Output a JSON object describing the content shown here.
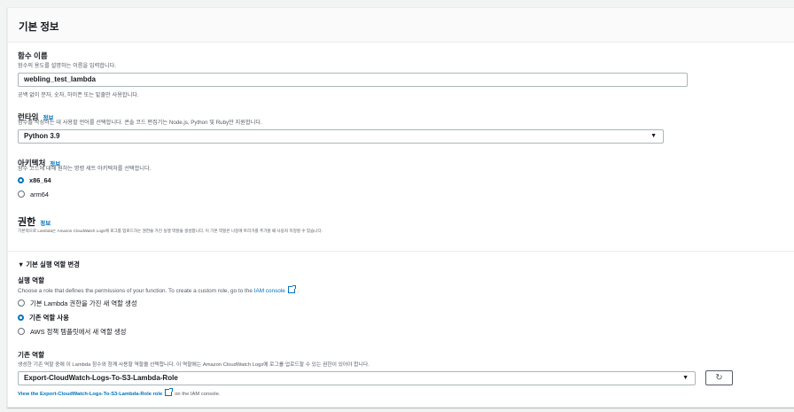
{
  "panel": {
    "title": "기본 정보"
  },
  "function_name": {
    "label": "함수 이름",
    "description": "함수의 용도를 설명하는 이름을 입력합니다.",
    "value": "webling_test_lambda",
    "constraint": "공백 없이 문자, 숫자, 하이픈 또는 밑줄만 사용합니다."
  },
  "runtime": {
    "label": "런타임",
    "info": "정보",
    "description": "함수를 작성하는 데 사용할 언어를 선택합니다. 콘솔 코드 편집기는 Node.js, Python 및 Ruby만 지원합니다.",
    "selected": "Python 3.9",
    "arrow": "▼"
  },
  "architecture": {
    "label": "아키텍처",
    "info": "정보",
    "description": "함수 코드에 대해 원하는 명령 세트 아키텍처를 선택합니다.",
    "options": [
      {
        "label": "x86_64",
        "checked": true
      },
      {
        "label": "arm64",
        "checked": false
      }
    ]
  },
  "permissions": {
    "title": "권한",
    "info": "정보",
    "description": "기본적으로 Lambda는 Amazon CloudWatch Logs에 로그를 업로드하는 권한을 가진 실행 역할을 생성합니다. 이 기본 역할은 나중에 트리거를 추가할 때 사용자 지정할 수 있습니다."
  },
  "execution_role_section": {
    "toggle": "▼ 기본 실행 역할 변경",
    "label": "실행 역할",
    "description_prefix": "Choose a role that defines the permissions of your function. To create a custom role, go to the ",
    "description_link": "IAM console",
    "description_suffix": ".",
    "options": [
      {
        "label": "기본 Lambda 권한을 가진 새 역할 생성",
        "checked": false
      },
      {
        "label": "기존 역할 사용",
        "checked": true
      },
      {
        "label": "AWS 정책 템플릿에서 새 역할 생성",
        "checked": false
      }
    ]
  },
  "existing_role": {
    "label": "기존 역할",
    "description": "생성한 기존 역할 중에 이 Lambda 함수와 함께 사용할 역할을 선택합니다. 이 역할에는 Amazon CloudWatch Logs에 로그를 업로드할 수 있는 권한이 있어야 합니다.",
    "selected": "Export-CloudWatch-Logs-To-S3-Lambda-Role",
    "arrow": "▼",
    "refresh_icon": "↻",
    "view_link": "View the Export-CloudWatch-Logs-To-S3-Lambda-Role role",
    "view_suffix": "on the IAM console."
  }
}
